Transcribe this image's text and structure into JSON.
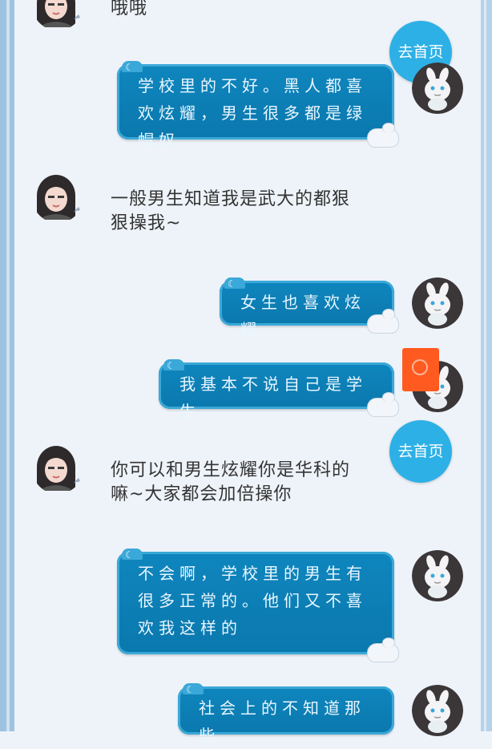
{
  "chat": {
    "messages": [
      {
        "side": "left",
        "type": "text",
        "text": "哦哦"
      },
      {
        "side": "right",
        "type": "bubble",
        "text": "学校里的不好。黑人都喜欢炫耀，男生很多都是绿帽奴"
      },
      {
        "side": "left",
        "type": "text",
        "text": "一般男生知道我是武大的都狠狠操我~"
      },
      {
        "side": "right",
        "type": "bubble",
        "text": "女生也喜欢炫耀"
      },
      {
        "side": "right",
        "type": "bubble",
        "text": "我基本不说自己是学生"
      },
      {
        "side": "left",
        "type": "text",
        "text": "你可以和男生炫耀你是华科的嘛~大家都会加倍操你"
      },
      {
        "side": "right",
        "type": "bubble",
        "text": "不会啊，学校里的男生有很多正常的。他们又不喜欢我这样的"
      },
      {
        "side": "right",
        "type": "bubble",
        "text": "社会上的不知道那些"
      }
    ]
  },
  "home_button": {
    "label": "去首页"
  },
  "icons": {
    "left_avatar": "girl-avatar-icon",
    "right_avatar": "bunny-avatar-icon",
    "bubble_decoration": "moon-icon",
    "bubble_corner": "cloud-cat-icon",
    "floating_widget": "loading-ring-icon"
  },
  "colors": {
    "background": "#eef3f9",
    "bubble": "#0a78ad",
    "bubble_text": "#e9f6ff",
    "home_button": "#2db0e6",
    "widget": "#ff5a1f"
  }
}
